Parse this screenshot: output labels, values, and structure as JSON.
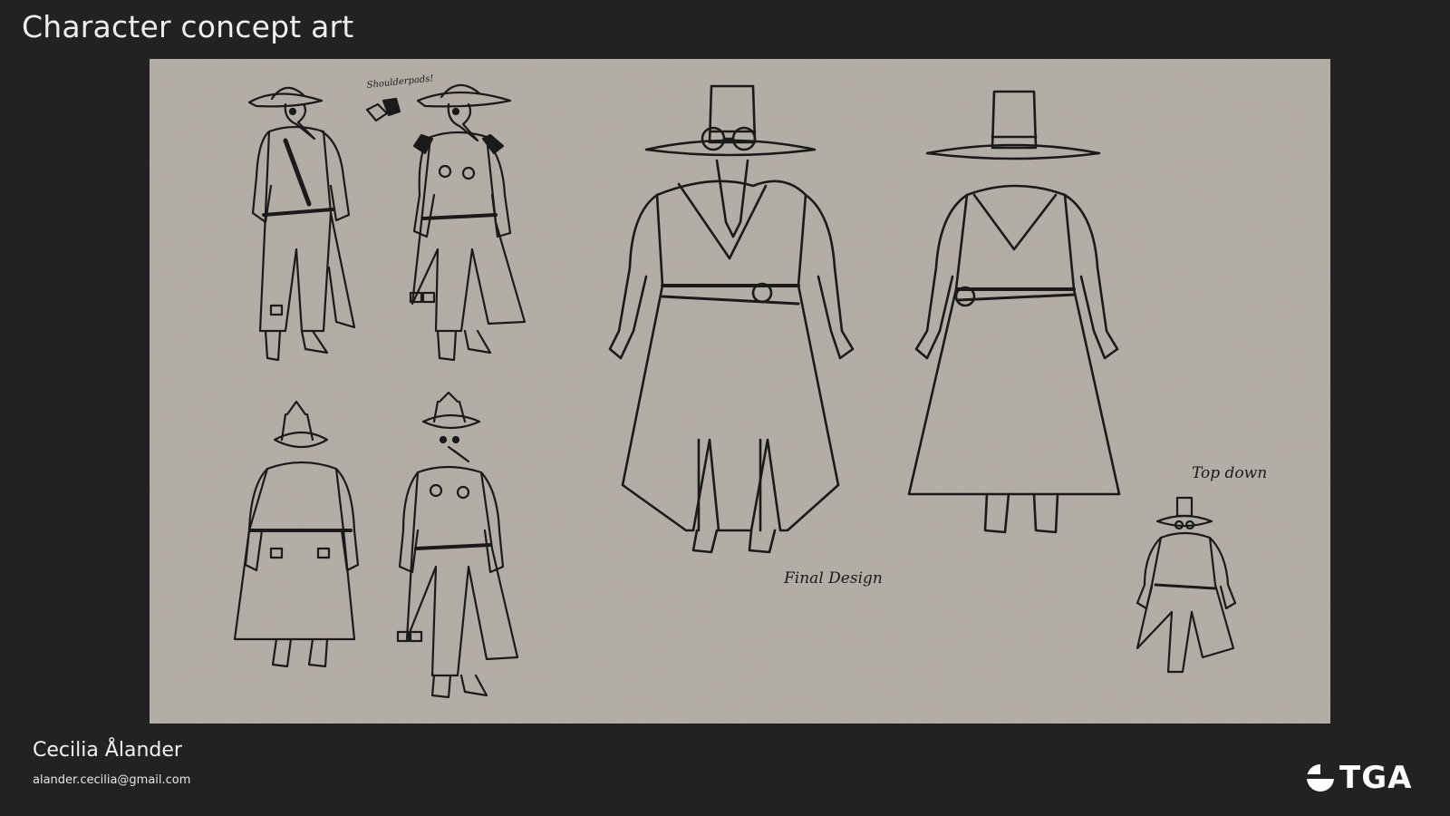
{
  "page": {
    "title": "Character concept art"
  },
  "artwork": {
    "notes": {
      "shoulderpads": "Shoulderpads!",
      "final_design": "Final Design",
      "top_down": "Top down"
    },
    "colors": {
      "paper": "#b4aea7",
      "ink": "#1a1a1a"
    }
  },
  "footer": {
    "artist_name": "Cecilia Ålander",
    "artist_email": "alander.cecilia@gmail.com",
    "logo_text": "TGA",
    "logo_icon": "tga-logo-icon"
  },
  "colors": {
    "background": "#222222",
    "text": "#eeeeee"
  }
}
